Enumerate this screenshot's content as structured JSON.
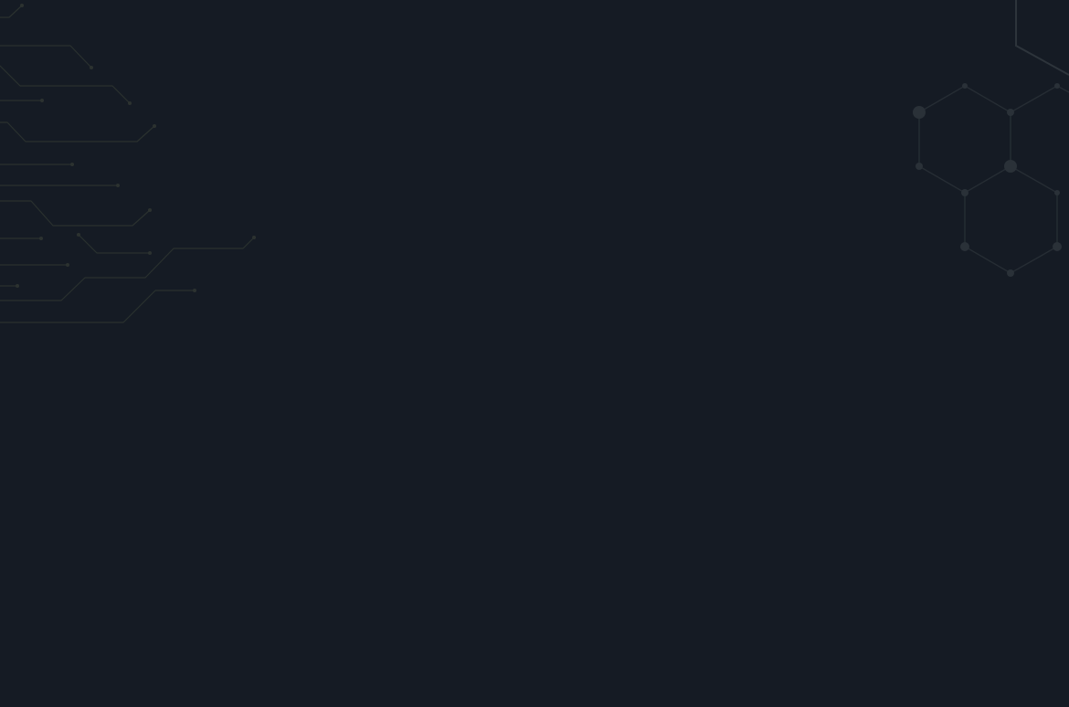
{
  "screen": {
    "background_color": "#151b24",
    "decor_circuit_color": "#2a312f",
    "decor_hex_color": "#262d34"
  },
  "icons": [
    "circuit-lines-decoration",
    "hexagon-network-decoration"
  ]
}
